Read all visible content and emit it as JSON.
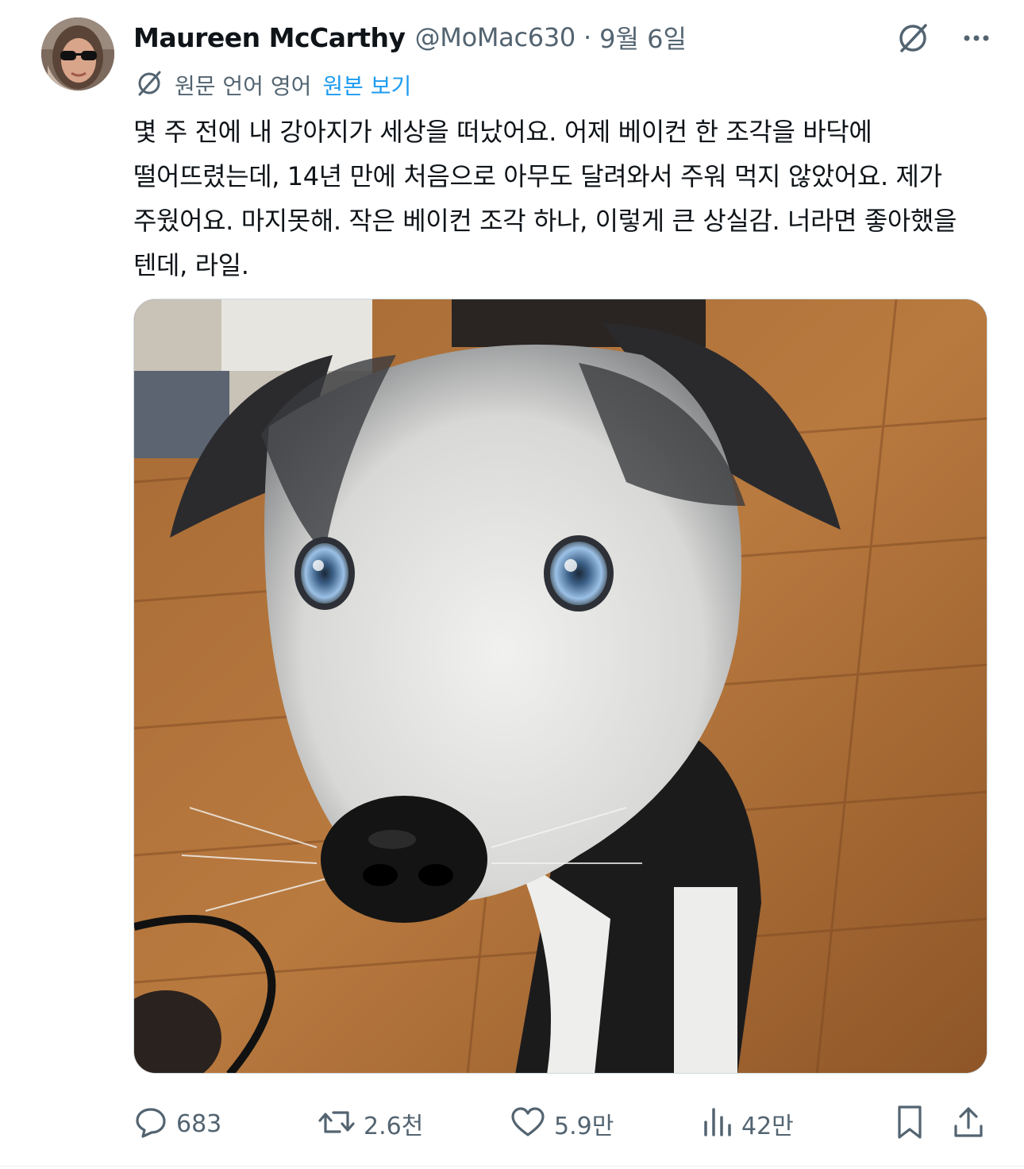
{
  "tweet": {
    "author_name": "Maureen McCarthy",
    "handle": "@MoMac630",
    "separator": "·",
    "date": "9월 6일",
    "translation": {
      "label": "원문 언어 영어",
      "view_original": "원본 보기"
    },
    "text": "몇 주 전에 내 강아지가 세상을 떠났어요. 어제 베이컨 한 조각을 바닥에 떨어뜨렸는데, 14년 만에 처음으로 아무도 달려와서 주워 먹지 않았어요. 제가 주웠어요. 마지못해. 작은 베이컨 조각 하나, 이렇게 큰 상실감. 너라면 좋아했을 텐데, 라일.",
    "metrics": {
      "replies": "683",
      "reposts": "2.6천",
      "likes": "5.9만",
      "views": "42만"
    }
  },
  "icons": {
    "grok": "grok-icon",
    "more": "more-icon",
    "translate": "translate-icon",
    "reply": "reply-icon",
    "repost": "repost-icon",
    "like": "heart-icon",
    "views": "views-icon",
    "bookmark": "bookmark-icon",
    "share": "share-icon"
  },
  "colors": {
    "text": "#0f1419",
    "secondary": "#536471",
    "link": "#1d9bf0",
    "border": "#cfd9de"
  }
}
